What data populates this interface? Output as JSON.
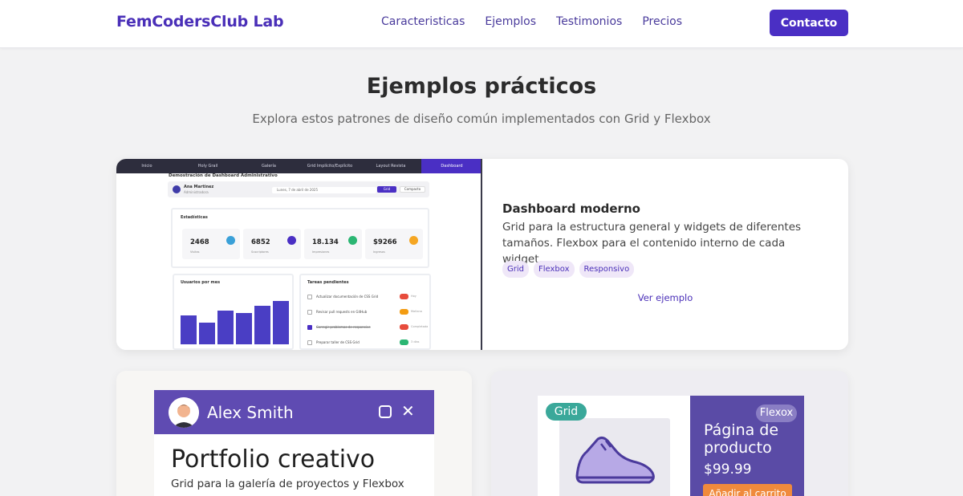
{
  "header": {
    "brand": "FemCodersClub Lab",
    "nav": [
      "Caracteristicas",
      "Ejemplos",
      "Testimonios",
      "Precios"
    ],
    "cta": "Contacto"
  },
  "section": {
    "title": "Ejemplos prácticos",
    "subtitle": "Explora estos patrones de diseño común implementados con Grid y Flexbox"
  },
  "featured": {
    "preview": {
      "tabs": [
        "Inicio",
        "Holy Grail",
        "Galería",
        "Grid Implícito/Explícito",
        "Layout Revista",
        "Dashboard"
      ],
      "active_tab": "Dashboard",
      "heading": "Demostración de Dashboard Administrativo",
      "user_name": "Ana Martinez",
      "user_role": "Administradora",
      "date": "Lunes, 7 de abril de 2025",
      "btn_grid": "Grid",
      "btn_compact": "Compacto",
      "stats_title": "Estadísticas",
      "stats": [
        {
          "value": "2468",
          "label": "Visitas",
          "color": "#3aa0d8"
        },
        {
          "value": "6852",
          "label": "Suscriptores",
          "color": "#4a2fc4"
        },
        {
          "value": "18.134",
          "label": "Impresiones",
          "color": "#2bb673"
        },
        {
          "value": "$9266",
          "label": "Ingresos",
          "color": "#f5a623"
        }
      ],
      "chart_title": "Usuarios por mes",
      "chart_values": [
        36,
        27,
        42,
        39,
        48,
        54
      ],
      "tasks_title": "Tareas pendientes",
      "tasks": [
        {
          "text": "Actualizar documentación de CSS Grid",
          "done": false,
          "badge": "#e74c3c",
          "small": "Hoy"
        },
        {
          "text": "Revisar pull requests en GitHub",
          "done": false,
          "badge": "#f39c12",
          "small": "Mañana"
        },
        {
          "text": "Corregir problemas de responsive",
          "done": true,
          "badge": "#e74c3c",
          "small": "Completada"
        },
        {
          "text": "Preparar taller de CSS Grid",
          "done": false,
          "badge": "#2bb673",
          "small": "3 días"
        }
      ]
    },
    "title": "Dashboard moderno",
    "description": "Grid para la estructura general y widgets de diferentes tamaños. Flexbox para el contenido interno de cada widget.",
    "tags": [
      "Grid",
      "Flexbox",
      "Responsivo"
    ],
    "link": "Ver ejemplo"
  },
  "portfolio": {
    "name": "Alex Smith",
    "title": "Portfolio creativo",
    "subtitle": "Grid para la galería de proyectos y Flexbox"
  },
  "product": {
    "grid_tag": "Grid",
    "flex_tag": "Flexox",
    "title": "Página de producto",
    "price": "$99.99",
    "button": "Añadir al carrito"
  }
}
